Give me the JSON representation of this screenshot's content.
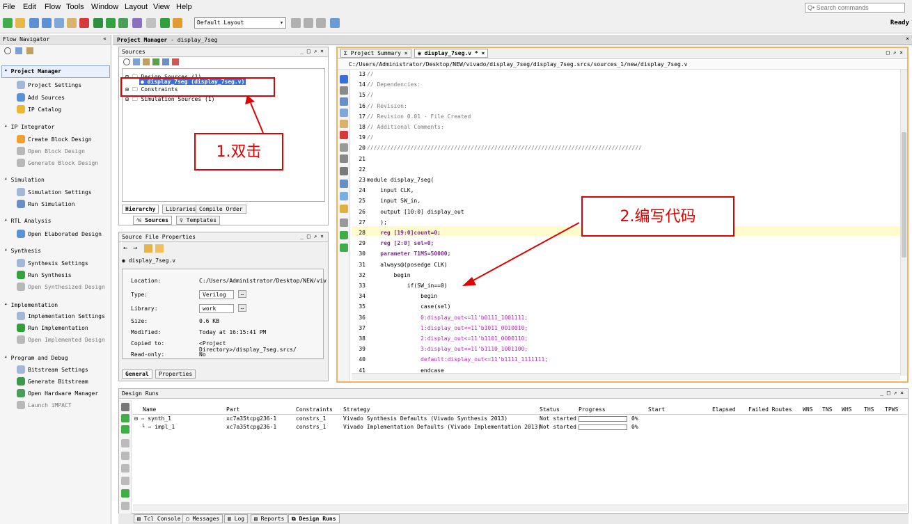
{
  "menu": [
    "File",
    "Edit",
    "Flow",
    "Tools",
    "Window",
    "Layout",
    "View",
    "Help"
  ],
  "search_placeholder": "Q• Search commands",
  "layout_select": "Default Layout",
  "status_right": "Ready",
  "flow_navigator": {
    "title": "Flow Navigator",
    "sections": [
      {
        "title": "Project Manager",
        "items": [
          "Project Settings",
          "Add Sources",
          "IP Catalog"
        ]
      },
      {
        "title": "IP Integrator",
        "items": [
          "Create Block Design",
          "Open Block Design",
          "Generate Block Design"
        ]
      },
      {
        "title": "Simulation",
        "items": [
          "Simulation Settings",
          "Run Simulation"
        ]
      },
      {
        "title": "RTL Analysis",
        "items": [
          "Open Elaborated Design"
        ]
      },
      {
        "title": "Synthesis",
        "items": [
          "Synthesis Settings",
          "Run Synthesis",
          "Open Synthesized Design"
        ]
      },
      {
        "title": "Implementation",
        "items": [
          "Implementation Settings",
          "Run Implementation",
          "Open Implemented Design"
        ]
      },
      {
        "title": "Program and Debug",
        "items": [
          "Bitstream Settings",
          "Generate Bitstream",
          "Open Hardware Manager",
          "Launch iMPACT"
        ]
      }
    ]
  },
  "project_manager": {
    "title": "Project Manager",
    "project": "display_7seg"
  },
  "sources": {
    "title": "Sources",
    "tree": [
      "Design Sources (1)",
      "display_7seg (display_7seg.v)",
      "Constraints",
      "Simulation Sources (1)"
    ],
    "tabs": [
      "Hierarchy",
      "Libraries",
      "Compile Order"
    ],
    "subtabs": [
      "Sources",
      "Templates"
    ]
  },
  "file_props": {
    "title": "Source File Properties",
    "file": "display_7seg.v",
    "rows": [
      {
        "label": "Location:",
        "value": "C:/Users/Administrator/Desktop/NEW/viv"
      },
      {
        "label": "Type:",
        "value": "Verilog"
      },
      {
        "label": "Library:",
        "value": "work"
      },
      {
        "label": "Size:",
        "value": "0.6 KB"
      },
      {
        "label": "Modified:",
        "value": "Today at 16:15:41 PM"
      },
      {
        "label": "Copied to:",
        "value": "<Project Directory>/display_7seg.srcs/"
      },
      {
        "label": "Read-only:",
        "value": "No"
      }
    ],
    "tabs": [
      "General",
      "Properties"
    ]
  },
  "editor": {
    "tabs": [
      "Project Summary",
      "display_7seg.v *"
    ],
    "path": "C:/Users/Administrator/Desktop/NEW/vivado/display_7seg/display_7seg.srcs/sources_1/new/display_7seg.v",
    "lines": [
      {
        "n": "13",
        "t": "//"
      },
      {
        "n": "14",
        "t": "// Dependencies:"
      },
      {
        "n": "15",
        "t": "//"
      },
      {
        "n": "16",
        "t": "// Revision:"
      },
      {
        "n": "17",
        "t": "// Revision 0.01 - File Created"
      },
      {
        "n": "18",
        "t": "// Additional Comments:"
      },
      {
        "n": "19",
        "t": "//"
      },
      {
        "n": "20",
        "t": "//////////////////////////////////////////////////////////////////////////////////"
      },
      {
        "n": "21",
        "t": ""
      },
      {
        "n": "22",
        "t": ""
      },
      {
        "n": "23",
        "t": "module display_7seg("
      },
      {
        "n": "24",
        "t": "    input CLK,"
      },
      {
        "n": "25",
        "t": "    input SW_in,"
      },
      {
        "n": "26",
        "t": "    output [10:0] display_out"
      },
      {
        "n": "27",
        "t": "    );"
      },
      {
        "n": "28",
        "t": "    reg [19:0]count=0;"
      },
      {
        "n": "29",
        "t": "    reg [2:0] sel=0;"
      },
      {
        "n": "30",
        "t": "    parameter T1MS=50000;"
      },
      {
        "n": "31",
        "t": "    always@(posedge CLK)"
      },
      {
        "n": "32",
        "t": "        begin"
      },
      {
        "n": "33",
        "t": "            if(SW_in==0)"
      },
      {
        "n": "34",
        "t": "                begin"
      },
      {
        "n": "35",
        "t": "                case(sel)"
      },
      {
        "n": "36",
        "t": "                0:display_out<=11'b0111_1001111;"
      },
      {
        "n": "37",
        "t": "                1:display_out<=11'b1011_0010010;"
      },
      {
        "n": "38",
        "t": "                2:display_out<=11'b1101_0000110;"
      },
      {
        "n": "39",
        "t": "                3:display_out<=11'b1110_1001100;"
      },
      {
        "n": "40",
        "t": "                default:display_out<=11'b1111_1111111;"
      },
      {
        "n": "41",
        "t": "                endcase"
      }
    ]
  },
  "callouts": {
    "one": "1.双击",
    "two": "2.编写代码"
  },
  "design_runs": {
    "title": "Design Runs",
    "columns": [
      "Name",
      "Part",
      "Constraints",
      "Strategy",
      "Status",
      "Progress",
      "Start",
      "Elapsed",
      "Failed Routes",
      "WNS",
      "TNS",
      "WHS",
      "THS",
      "TPWS"
    ],
    "rows": [
      {
        "name": "synth_1",
        "part": "xc7a35tcpg236-1",
        "constraints": "constrs_1",
        "strategy": "Vivado Synthesis Defaults (Vivado Synthesis 2013)",
        "status": "Not started",
        "progress": "0%"
      },
      {
        "name": "impl_1",
        "part": "xc7a35tcpg236-1",
        "constraints": "constrs_1",
        "strategy": "Vivado Implementation Defaults (Vivado Implementation 2013)",
        "status": "Not started",
        "progress": "0%"
      }
    ]
  },
  "bottom_tabs": [
    "Tcl Console",
    "Messages",
    "Log",
    "Reports",
    "Design Runs"
  ],
  "colors": {
    "accent": "#f2b45a",
    "callout": "#e10000",
    "selection": "#3a6fd8"
  }
}
